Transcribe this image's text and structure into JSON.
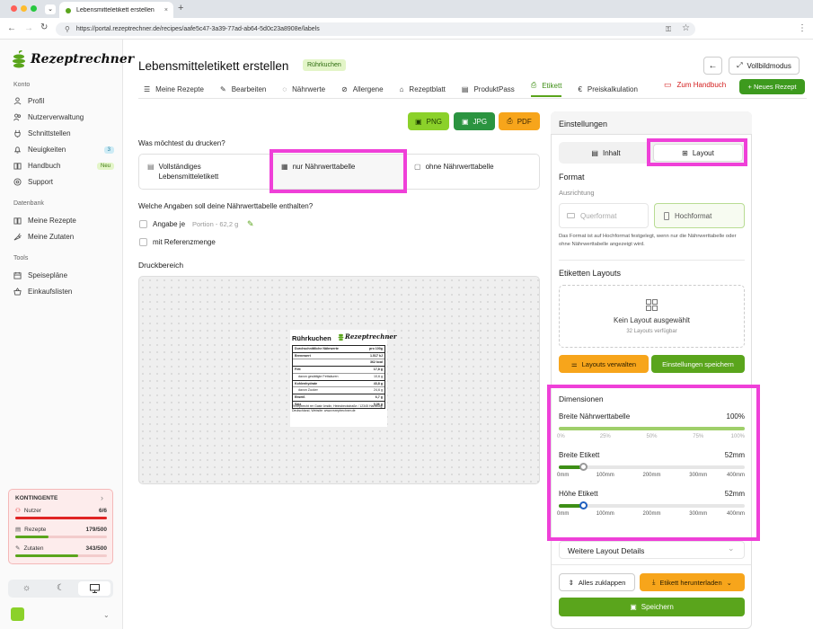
{
  "browser": {
    "tab_title": "Lebensmitteletikett erstellen",
    "url": "https://portal.rezeptrechner.de/recipes/aafe5c47-3a39-77ad-ab64-5d0c23a8908e/labels"
  },
  "sidebar": {
    "logo": "Rezeptrechner",
    "sections": {
      "konto": "Konto",
      "datenbank": "Datenbank",
      "tools": "Tools"
    },
    "konto_items": [
      {
        "label": "Profil",
        "icon": "user-icon"
      },
      {
        "label": "Nutzerverwaltung",
        "icon": "users-icon"
      },
      {
        "label": "Schnittstellen",
        "icon": "plug-icon"
      },
      {
        "label": "Neuigkeiten",
        "icon": "bell-icon",
        "badge": "3"
      },
      {
        "label": "Handbuch",
        "icon": "book-icon",
        "badge": "Neu"
      },
      {
        "label": "Support",
        "icon": "help-icon"
      }
    ],
    "datenbank_items": [
      {
        "label": "Meine Rezepte",
        "icon": "book-icon"
      },
      {
        "label": "Meine Zutaten",
        "icon": "carrot-icon"
      }
    ],
    "tools_items": [
      {
        "label": "Speisepläne",
        "icon": "calendar-icon"
      },
      {
        "label": "Einkaufslisten",
        "icon": "basket-icon"
      }
    ],
    "kontingente": {
      "title": "KONTINGENTE",
      "items": [
        {
          "label": "Nutzer",
          "value": "6/6",
          "fraction": 1.0,
          "color": "#e02424"
        },
        {
          "label": "Rezepte",
          "value": "179/500",
          "fraction": 0.358,
          "color": "#5aa51c"
        },
        {
          "label": "Zutaten",
          "value": "343/500",
          "fraction": 0.686,
          "color": "#5aa51c"
        }
      ]
    }
  },
  "header": {
    "title": "Lebensmitteletikett erstellen",
    "recipe_badge": "Rührkuchen",
    "fullscreen": "Vollbildmodus"
  },
  "tabs": [
    {
      "label": "Meine Rezepte"
    },
    {
      "label": "Bearbeiten"
    },
    {
      "label": "Nährwerte"
    },
    {
      "label": "Allergene"
    },
    {
      "label": "Rezeptblatt"
    },
    {
      "label": "ProduktPass"
    },
    {
      "label": "Etikett",
      "active": true
    },
    {
      "label": "Preiskalkulation"
    }
  ],
  "actions": {
    "handbuch": "Zum Handbuch",
    "new_recipe": "+ Neues Rezept"
  },
  "export": {
    "png": "PNG",
    "jpg": "JPG",
    "pdf": "PDF"
  },
  "print": {
    "question": "Was möchtest du drucken?",
    "options": [
      "Vollständiges Lebensmitteletikett",
      "nur Nährwerttabelle",
      "ohne Nährwerttabelle"
    ]
  },
  "details": {
    "question": "Welche Angaben soll deine Nährwerttabelle enthalten?",
    "angabe": "Angabe je",
    "portion": "Portion - 62,2 g",
    "referenz": "mit Referenzmenge"
  },
  "druckbereich": {
    "title": "Druckbereich",
    "label": {
      "name": "Rührkuchen",
      "brand": "Rezeptrechner",
      "header_left": "Durchschnittliche Nährwerte",
      "header_right": "pro 100g",
      "rows": [
        {
          "n": "Brennwert",
          "v": "1.517 kJ",
          "bold": true
        },
        {
          "n": "",
          "v": "362 kcal",
          "bold": true
        },
        {
          "n": "Fett",
          "v": "17,8 g",
          "bold": true
        },
        {
          "n": "davon gesättigte Fettsäuren",
          "v": "10,6 g",
          "bold": false
        },
        {
          "n": "Kohlenhydrate",
          "v": "43,8 g",
          "bold": true
        },
        {
          "n": "davon Zucker",
          "v": "24,6 g",
          "bold": false
        },
        {
          "n": "Eiweiß",
          "v": "6,7 g",
          "bold": true
        },
        {
          "n": "Salz",
          "v": "0,36 g",
          "bold": true
        }
      ],
      "footer": "Rezeptrecht rer Gastr ömdin, Heinsbeckstraße / 12345 Hamburg, Deutschland, Website: www.rezeptrechner.de"
    }
  },
  "settings": {
    "title": "Einstellungen",
    "tab_inhalt": "Inhalt",
    "tab_layout": "Layout",
    "format_title": "Format",
    "ausrichtung": "Ausrichtung",
    "querformat": "Querformat",
    "hochformat": "Hochformat",
    "format_note": "Das Format ist auf Hochformat festgelegt, wenn nur die Nährwerttabelle oder ohne Nährwerttabelle angezeigt wird.",
    "layouts_title": "Etiketten Layouts",
    "no_layout": "Kein Layout ausgewählt",
    "layouts_count": "32 Layouts verfügbar",
    "manage": "Layouts verwalten",
    "save_settings": "Einstellungen speichern",
    "dimensions_title": "Dimensionen",
    "breite_naehr": {
      "label": "Breite Nährwerttabelle",
      "value": "100%",
      "fraction": 1.0,
      "ticks": [
        "0%",
        "25%",
        "50%",
        "75%",
        "100%"
      ]
    },
    "breite_etikett": {
      "label": "Breite Etikett",
      "value": "52mm",
      "fraction": 0.13,
      "ticks": [
        "0mm",
        "100mm",
        "200mm",
        "300mm",
        "400mm"
      ]
    },
    "hoehe_etikett": {
      "label": "Höhe Etikett",
      "value": "52mm",
      "fraction": 0.13,
      "ticks": [
        "0mm",
        "100mm",
        "200mm",
        "300mm",
        "400mm"
      ]
    },
    "weitere": "Weitere Layout Details",
    "collapse": "Alles zuklappen",
    "download": "Etikett herunterladen",
    "save": "Speichern"
  },
  "colors": {
    "green": "#5aa51c",
    "dark_green": "#2f8f2f",
    "orange": "#f7a51b",
    "lime": "#8bd12a",
    "highlight": "#ef40d8",
    "red": "#e02424"
  }
}
